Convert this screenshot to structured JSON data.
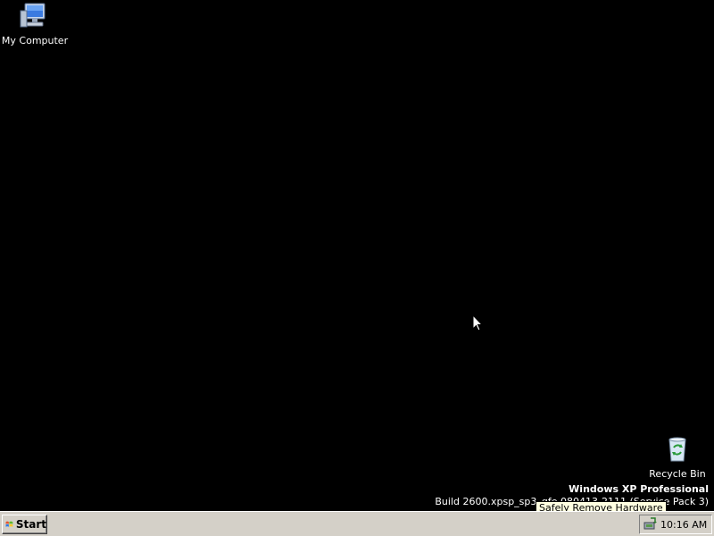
{
  "desktop": {
    "icons": [
      {
        "label": "My Computer",
        "icon": "my-computer-icon"
      },
      {
        "label": "Recycle Bin",
        "icon": "recycle-bin-icon"
      }
    ],
    "watermark": {
      "title": "Windows XP Professional",
      "build": "Build 2600.xpsp_sp3_qfe.080413-2111 (Service Pack 3)"
    },
    "tooltip": "Safely Remove Hardware",
    "background_color": "#000000"
  },
  "taskbar": {
    "start_label": "Start",
    "tray": {
      "icon": "safely-remove-hardware-icon",
      "clock": "10:16 AM"
    },
    "background_color": "#d4d0c8"
  }
}
